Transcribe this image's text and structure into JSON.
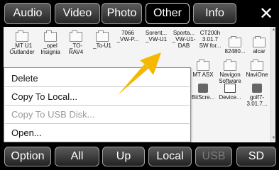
{
  "tabs": [
    {
      "label": "Audio",
      "active": false
    },
    {
      "label": "Video",
      "active": false
    },
    {
      "label": "Photo",
      "active": false
    },
    {
      "label": "Other",
      "active": true
    },
    {
      "label": "Info",
      "active": false
    }
  ],
  "close_label": "✕",
  "files": [
    {
      "icon": "folder",
      "name": "_MT U1\nOutlander"
    },
    {
      "icon": "folder",
      "name": "_opel\nInsignia"
    },
    {
      "icon": "folder",
      "name": "_TO-\nRAV4"
    },
    {
      "icon": "folder",
      "name": "_To-U1"
    },
    {
      "icon": "folder",
      "name": "7066\n_VW-P..."
    },
    {
      "icon": "folder",
      "name": "Sorent...\n_VW-U1"
    },
    {
      "icon": "folder",
      "name": "Sporta...\n_VW-U1-\nDAB"
    },
    {
      "icon": "folder",
      "name": "CT200h\n3.01.7\nSW for..."
    },
    {
      "icon": "folder",
      "name": "82480..."
    },
    {
      "icon": "folder",
      "name": "alcar"
    },
    {
      "icon": "folder",
      "name": "MT ASX"
    },
    {
      "icon": "folder",
      "name": "Navigon\nSoftware"
    },
    {
      "icon": "folder",
      "name": "NaviOne"
    },
    {
      "icon": "app",
      "name": "BitScre..."
    },
    {
      "icon": "doc",
      "name": "Device..."
    },
    {
      "icon": "app",
      "name": "golf7-\n3.01.7..."
    }
  ],
  "menu": {
    "items": [
      {
        "label": "Delete",
        "enabled": true
      },
      {
        "label": "Copy To Local...",
        "enabled": true
      },
      {
        "label": "Copy To USB Disk...",
        "enabled": false
      },
      {
        "label": "Open...",
        "enabled": true
      }
    ]
  },
  "bottom_buttons": [
    {
      "label": "Option",
      "enabled": true
    },
    {
      "label": "All",
      "enabled": true
    },
    {
      "label": "Up",
      "enabled": true
    },
    {
      "label": "Local",
      "enabled": true
    },
    {
      "label": "USB",
      "enabled": false
    },
    {
      "label": "SD",
      "enabled": true
    }
  ],
  "colors": {
    "accent_arrow": "#f5b800"
  }
}
